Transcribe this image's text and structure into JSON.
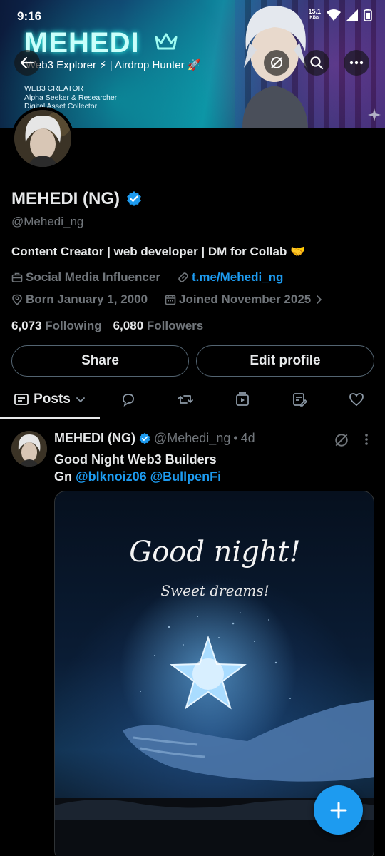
{
  "status_bar": {
    "time": "9:16",
    "net_speed_value": "15.1",
    "net_speed_unit": "KB/s"
  },
  "banner": {
    "name": "MEHEDI",
    "tagline": "Web3 Explorer ⚡ | Airdrop Hunter 🚀",
    "lines": [
      "WEB3 CREATOR",
      "Alpha Seeker & Researcher",
      "Digital Asset Collector"
    ]
  },
  "profile": {
    "display_name": "MEHEDI (NG)",
    "handle": "@Mehedi_ng",
    "bio": "Content Creator | web developer |  DM for Collab 🤝",
    "category": "Social Media Influencer",
    "website": "t.me/Mehedi_ng",
    "birthday": "Born January 1, 2000",
    "joined": "Joined November 2025",
    "following_count": "6,073",
    "following_label": "Following",
    "followers_count": "6,080",
    "followers_label": "Followers"
  },
  "actions": {
    "share_label": "Share",
    "edit_label": "Edit profile"
  },
  "tabs": {
    "posts_label": "Posts"
  },
  "post": {
    "author": "MEHEDI (NG)",
    "handle": "@Mehedi_ng",
    "separator": "•",
    "time": "4d",
    "line1": "Good Night Web3 Builders",
    "line2_prefix": "Gn",
    "mention1": "@blknoiz06",
    "mention2": "@BullpenFi",
    "image_title": "Good night!",
    "image_subtitle": "Sweet dreams!"
  },
  "colors": {
    "accent": "#1d9bf0",
    "muted": "#71767b",
    "text": "#e7e9ea",
    "background": "#000000"
  }
}
